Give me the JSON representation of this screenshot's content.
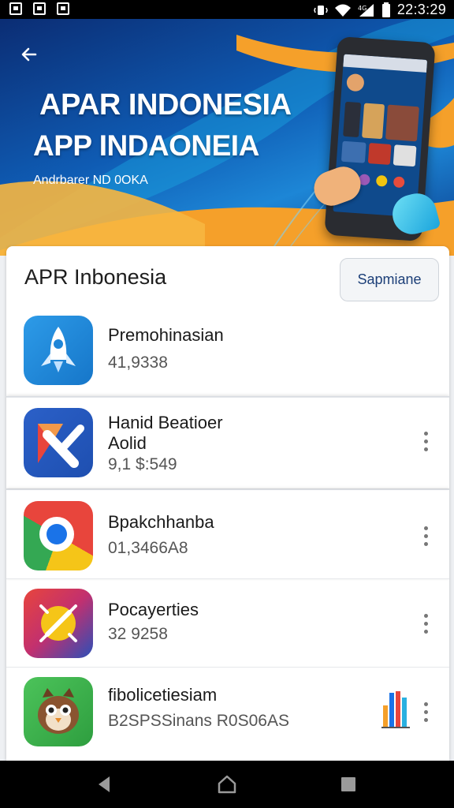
{
  "status_bar": {
    "time": "22:3:29",
    "icons": [
      "notification-icon",
      "notification-icon",
      "notification-icon",
      "vibrate-icon",
      "wifi-icon",
      "signal-icon",
      "battery-icon"
    ]
  },
  "banner": {
    "title_line1": "APAR INDONESIA",
    "title_line2": "APP INDAONEIA",
    "subtitle": "Andrbarer ND 0OKA",
    "accent_color": "#f5a02a",
    "background_color": "#0f5cb4"
  },
  "section": {
    "title": "APR Inbonesia",
    "action_label": "Sapmiane"
  },
  "apps": [
    {
      "name": "Premohinasian",
      "meta": "41,9338",
      "icon": "rocket-app-icon",
      "has_menu": false
    },
    {
      "name_line1": "Hanid Beatioer",
      "name_line2": "Aolid",
      "meta": "9,1 $:549",
      "icon": "directions-app-icon",
      "has_menu": true
    },
    {
      "name": "Bpakchhanba",
      "meta": "01,3466A8",
      "icon": "browser-app-icon",
      "has_menu": true
    },
    {
      "name": "Pocayerties",
      "meta": "32 9258",
      "icon": "compass-app-icon",
      "has_menu": true
    },
    {
      "name": "fibolicetiesiam",
      "meta": "B2SPSSinans R0S06AS",
      "icon": "owl-app-icon",
      "has_menu": true,
      "has_chart_icon": true
    }
  ],
  "nav_bar": {
    "buttons": [
      "back",
      "home",
      "recents"
    ]
  }
}
